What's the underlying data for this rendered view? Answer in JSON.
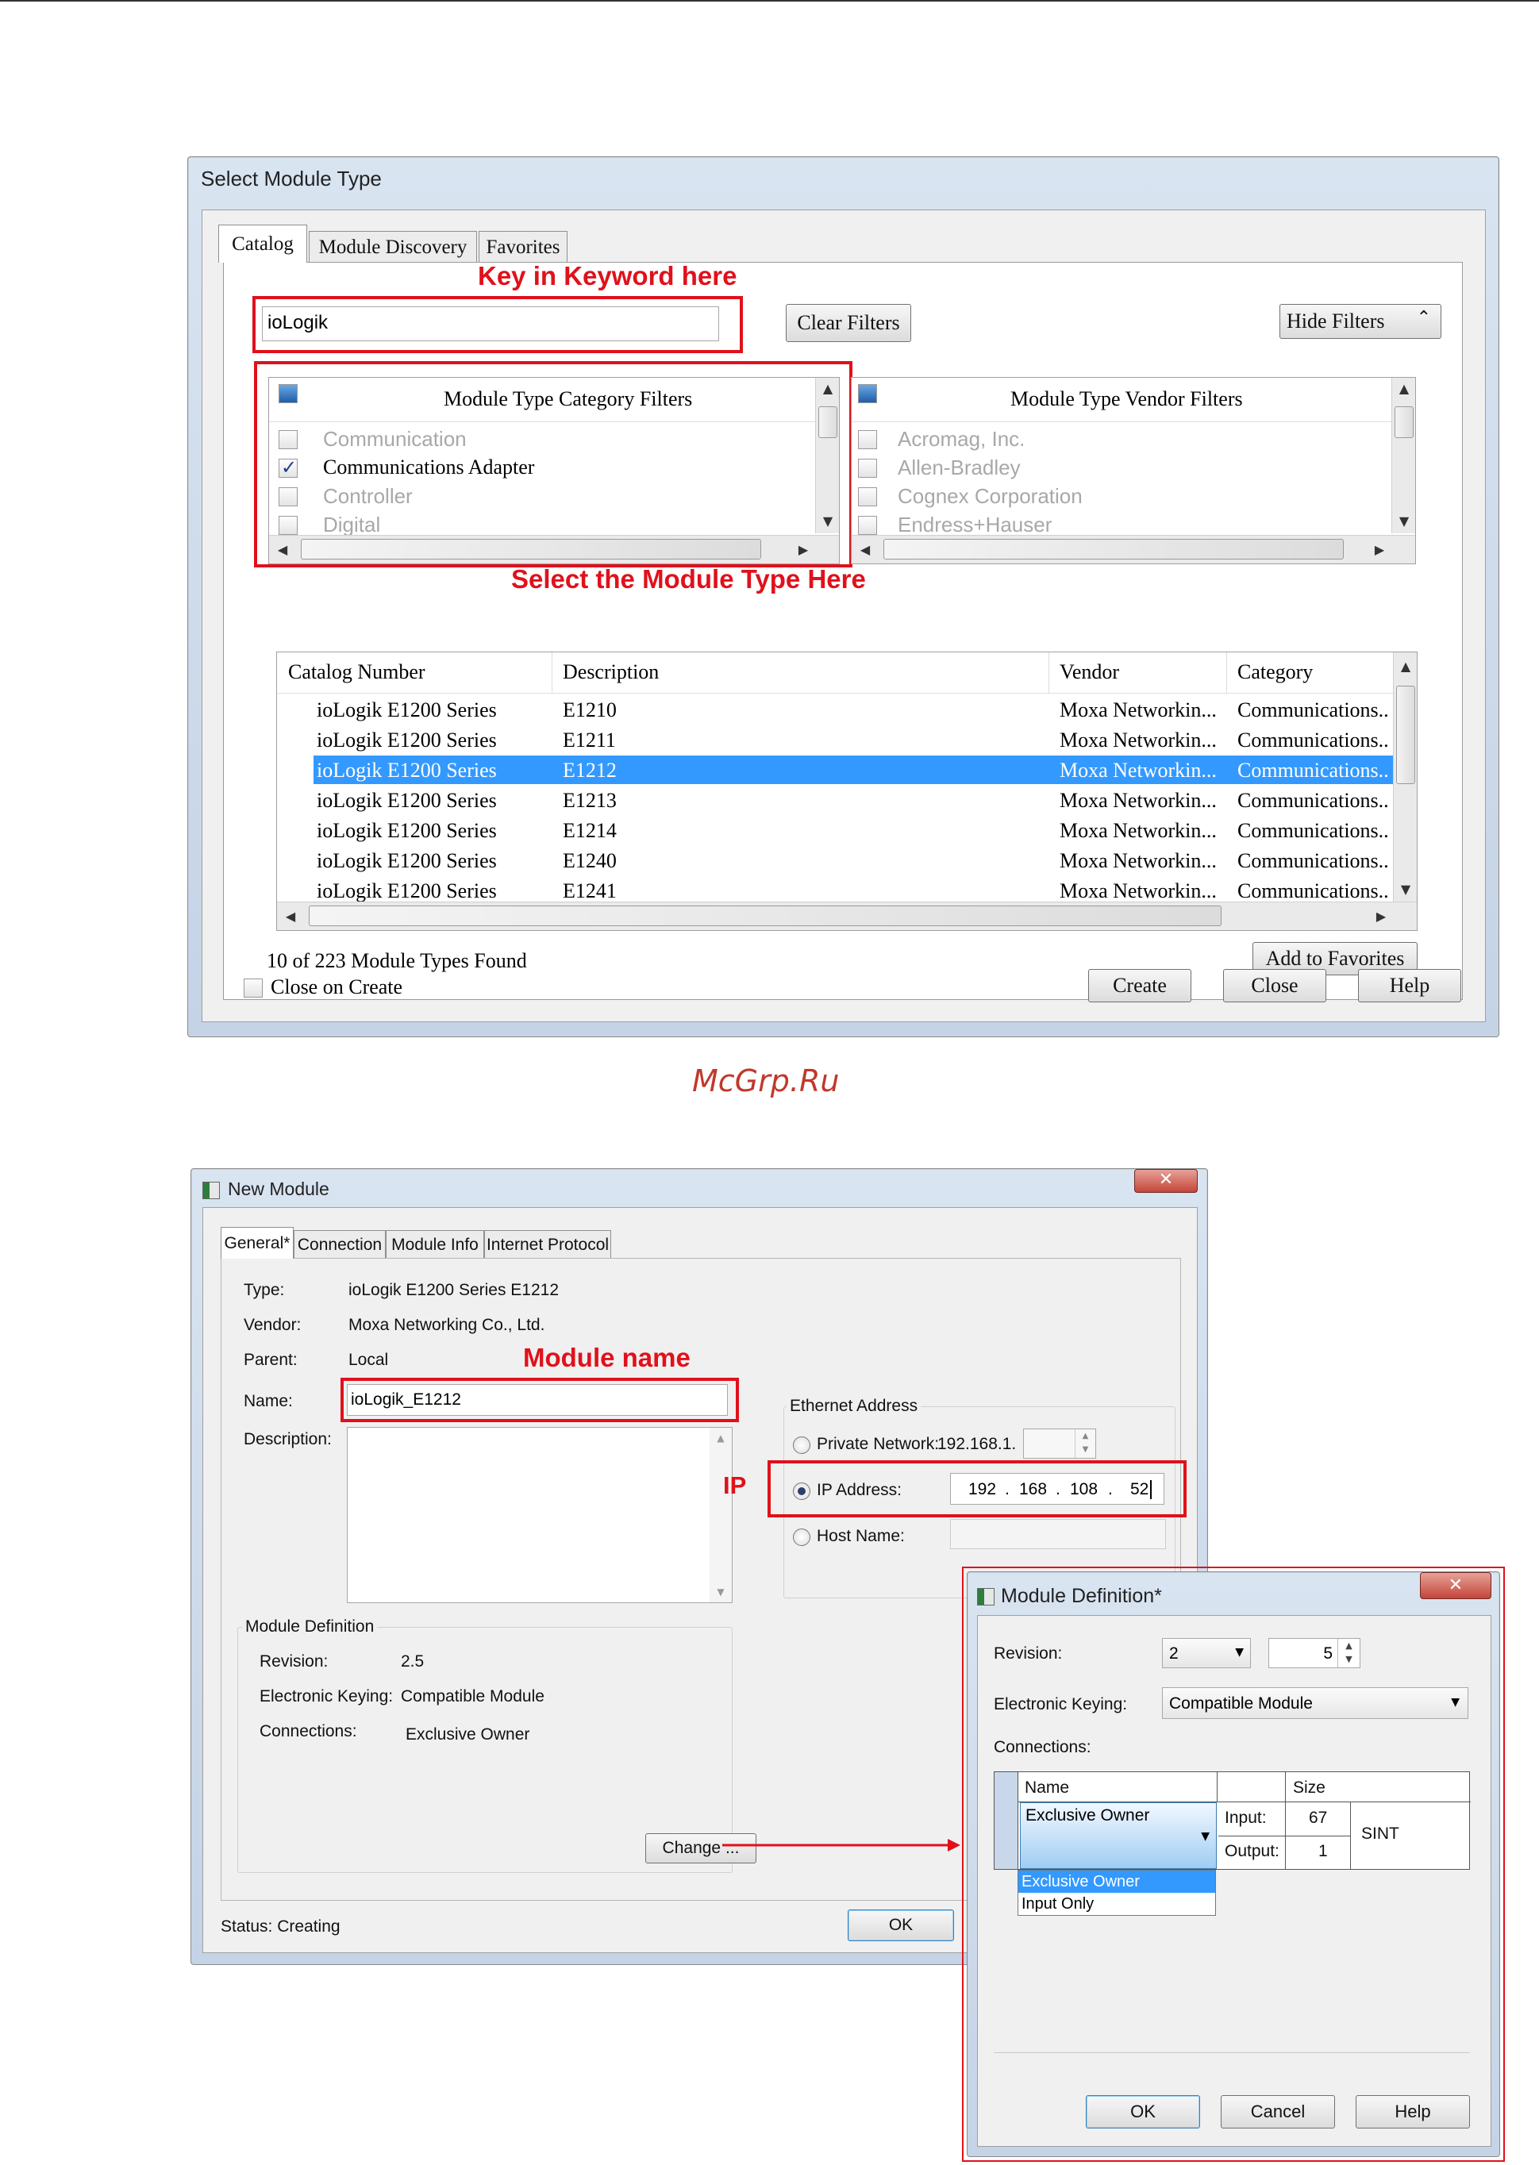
{
  "watermark": "McGrp.Ru",
  "select_module": {
    "title": "Select Module Type",
    "tabs": [
      "Catalog",
      "Module Discovery",
      "Favorites"
    ],
    "annotation_keyword": "Key in Keyword here",
    "annotation_module_type": "Select the Module Type Here",
    "search_value": "ioLogik",
    "clear_filters": "Clear Filters",
    "hide_filters": "Hide Filters",
    "category_filter_title": "Module Type Category Filters",
    "categories": [
      {
        "label": "Communication",
        "checked": false,
        "enabled": false
      },
      {
        "label": "Communications Adapter",
        "checked": true,
        "enabled": true
      },
      {
        "label": "Controller",
        "checked": false,
        "enabled": false
      },
      {
        "label": "Digital",
        "checked": false,
        "enabled": false
      }
    ],
    "vendor_filter_title": "Module Type Vendor Filters",
    "vendors": [
      "Acromag, Inc.",
      "Allen-Bradley",
      "Cognex Corporation",
      "Endress+Hauser"
    ],
    "columns": [
      "Catalog Number",
      "Description",
      "Vendor",
      "Category"
    ],
    "rows": [
      [
        "ioLogik E1200 Series",
        "E1210",
        "Moxa Networkin...",
        "Communications..."
      ],
      [
        "ioLogik E1200 Series",
        "E1211",
        "Moxa Networkin...",
        "Communications..."
      ],
      [
        "ioLogik E1200 Series",
        "E1212",
        "Moxa Networkin...",
        "Communications..."
      ],
      [
        "ioLogik E1200 Series",
        "E1213",
        "Moxa Networkin...",
        "Communications..."
      ],
      [
        "ioLogik E1200 Series",
        "E1214",
        "Moxa Networkin...",
        "Communications..."
      ],
      [
        "ioLogik E1200 Series",
        "E1240",
        "Moxa Networkin...",
        "Communications..."
      ],
      [
        "ioLogik E1200 Series",
        "E1241",
        "Moxa Networkin...",
        "Communications..."
      ]
    ],
    "selected_row": 2,
    "found_text": "10  of 223 Module Types Found",
    "add_favorites": "Add to Favorites",
    "close_on_create": "Close on Create",
    "create": "Create",
    "close": "Close",
    "help": "Help"
  },
  "new_module": {
    "title": "New Module",
    "tabs": [
      "General*",
      "Connection",
      "Module Info",
      "Internet Protocol"
    ],
    "type_label": "Type:",
    "type_value": "ioLogik E1200 Series E1212",
    "vendor_label": "Vendor:",
    "vendor_value": "Moxa Networking Co., Ltd.",
    "parent_label": "Parent:",
    "parent_value": "Local",
    "name_label": "Name:",
    "name_value": "ioLogik_E1212",
    "description_label": "Description:",
    "annotation_module_name": "Module name",
    "annotation_ip": "IP",
    "ethernet_label": "Ethernet Address",
    "private_network_label": "Private Network:",
    "private_network_prefix": "192.168.1.",
    "ip_address_label": "IP Address:",
    "ip_octets": [
      "192",
      "168",
      "108",
      "52"
    ],
    "host_name_label": "Host Name:",
    "module_definition_label": "Module Definition",
    "revision_label": "Revision:",
    "revision_value": "2.5",
    "keying_label": "Electronic Keying:",
    "keying_value": "Compatible Module",
    "connections_label": "Connections:",
    "connections_value": "Exclusive Owner",
    "change_button": "Change ...",
    "status_text": "Status:  Creating",
    "ok": "OK"
  },
  "module_definition": {
    "title": "Module Definition*",
    "revision_label": "Revision:",
    "revision_major": "2",
    "revision_minor": "5",
    "keying_label": "Electronic Keying:",
    "keying_value": "Compatible Module",
    "connections_label": "Connections:",
    "col_name": "Name",
    "col_size": "Size",
    "connection_name": "Exclusive Owner",
    "input_label": "Input:",
    "input_size": "67",
    "output_label": "Output:",
    "output_size": "1",
    "size_type": "SINT",
    "dropdown_options": [
      "Exclusive Owner",
      "Input Only"
    ],
    "ok": "OK",
    "cancel": "Cancel",
    "help": "Help"
  },
  "colors": {
    "annotation_red": "#e0111b",
    "selection_blue": "#3399ff"
  }
}
